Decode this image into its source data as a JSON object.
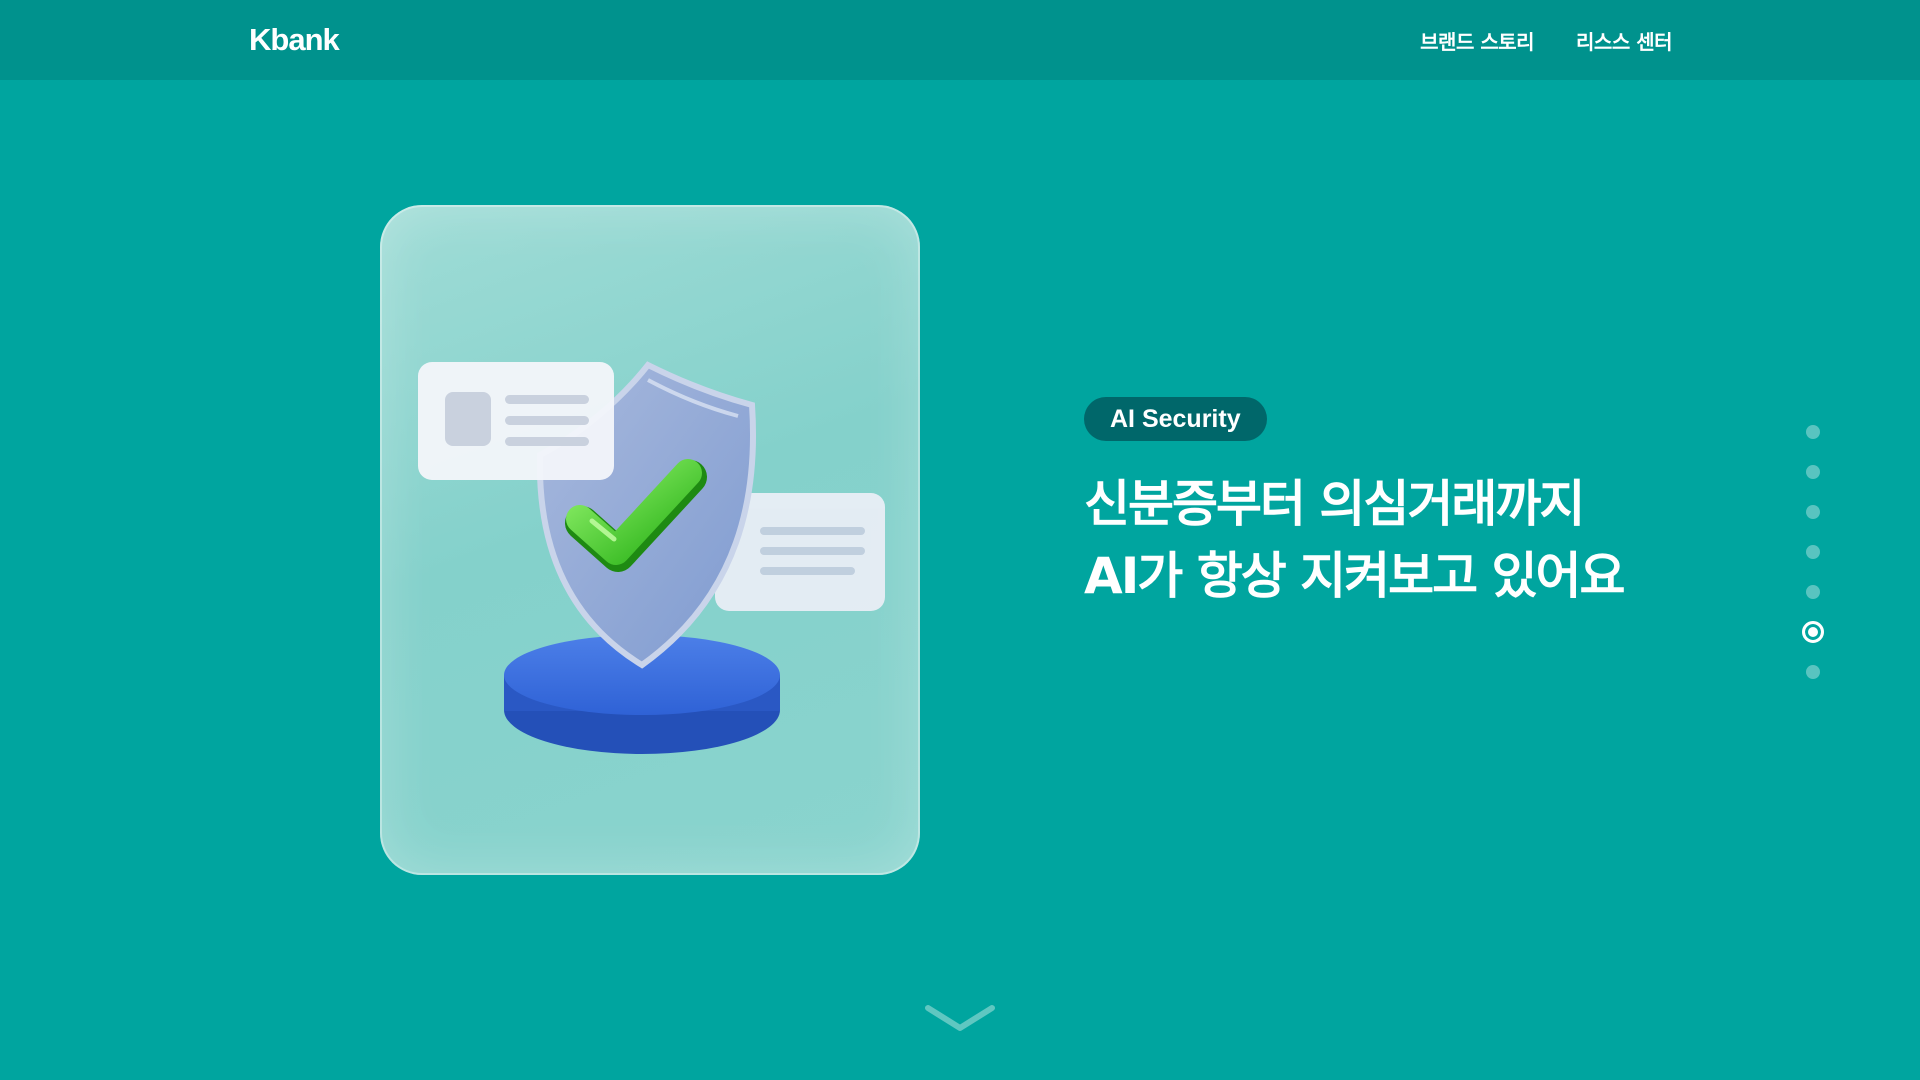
{
  "header": {
    "logo": "Kbank",
    "nav": [
      {
        "label": "브랜드 스토리"
      },
      {
        "label": "리스스 센터"
      }
    ]
  },
  "hero": {
    "badge": "AI Security",
    "headline_line1": "신분증부터 의심거래까지",
    "headline_line2": "AI가 항상 지켜보고 있어요",
    "illustration": "shield-check-icon"
  },
  "pagination": {
    "total": 7,
    "active_index": 5
  },
  "scroll": {
    "icon": "chevron-down-icon"
  },
  "colors": {
    "background": "#00a59f",
    "header": "#00928d",
    "badge": "#00676a",
    "check": "#3fc41e",
    "pedestal": "#2f62d6"
  }
}
